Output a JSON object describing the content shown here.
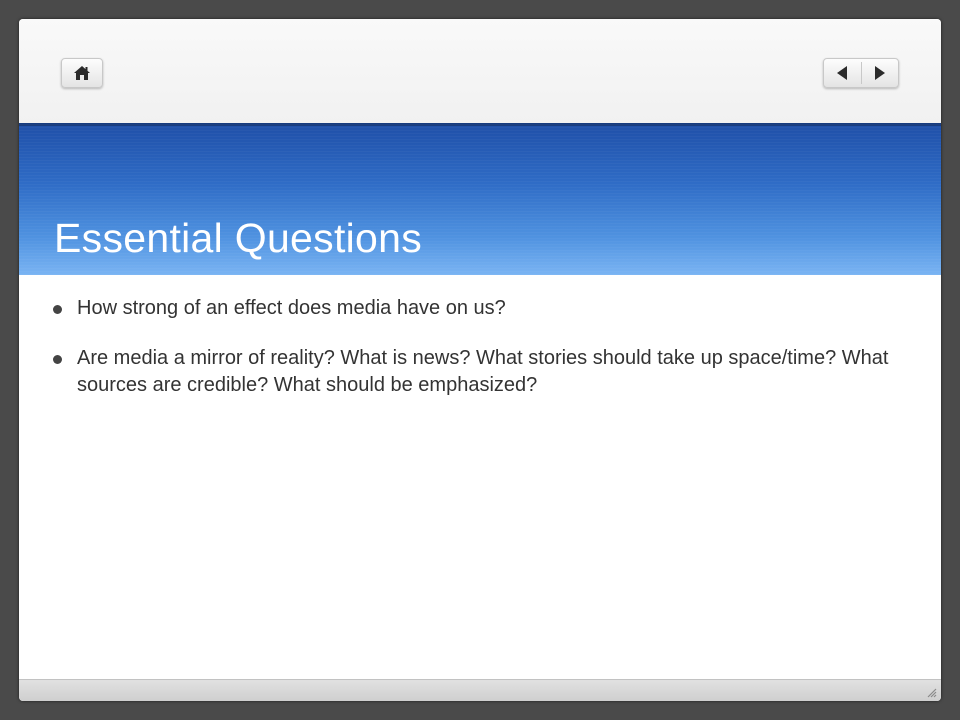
{
  "navigation": {
    "home_icon": "home-icon",
    "previous_icon": "triangle-left-icon",
    "next_icon": "triangle-right-icon"
  },
  "slide": {
    "title": "Essential Questions",
    "bullets": [
      "How strong of an effect does media have on us?",
      "Are media a mirror of reality? What is news? What stories should take up space/time? What sources are credible? What should be emphasized?"
    ]
  },
  "colors": {
    "title_band_top": "#1f4fa8",
    "title_band_bottom": "#7ab4f3",
    "title_text": "#ffffff",
    "body_text": "#333333",
    "frame": "#4a4a4a"
  }
}
